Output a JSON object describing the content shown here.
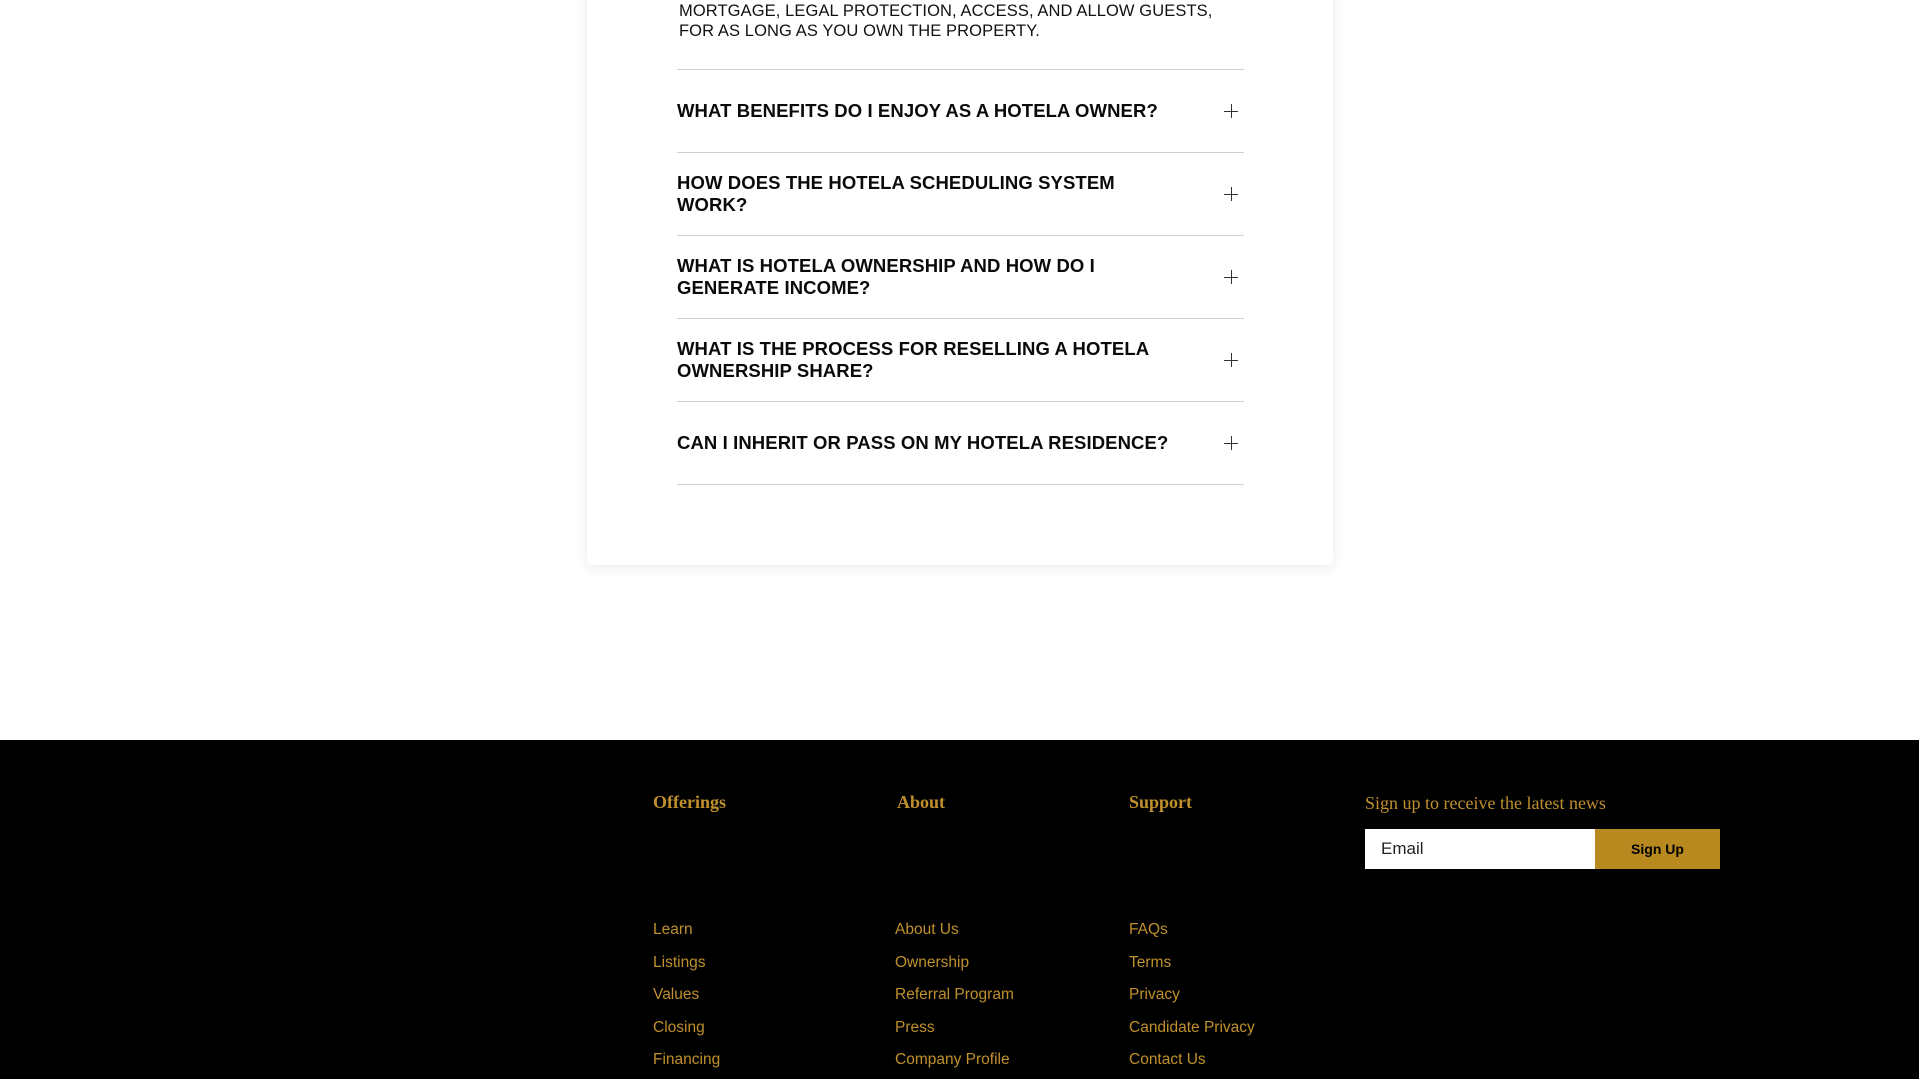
{
  "faq": {
    "answer_text": "MORTGAGE, LEGAL PROTECTION, ACCESS, AND ALLOW GUESTS, FOR AS LONG AS YOU OWN THE PROPERTY.",
    "questions": [
      "WHAT BENEFITS DO I ENJOY AS A HOTELA OWNER?",
      "HOW DOES THE HOTELA SCHEDULING SYSTEM WORK?",
      "WHAT IS HOTELA OWNERSHIP AND HOW DO I GENERATE INCOME?",
      "WHAT IS THE PROCESS FOR RESELLING A HOTELA OWNERSHIP SHARE?",
      "CAN I INHERIT OR PASS ON MY HOTELA RESIDENCE?"
    ]
  },
  "footer": {
    "offerings": {
      "heading": "Offerings",
      "links": [
        "Learn",
        "Listings",
        "Values",
        "Closing",
        "Financing"
      ]
    },
    "about": {
      "heading": "About",
      "links": [
        "About Us",
        "Ownership",
        "Referral Program",
        "Press",
        "Company Profile"
      ]
    },
    "support": {
      "heading": "Support",
      "links": [
        "FAQs",
        "Terms",
        "Privacy",
        "Candidate Privacy",
        "Contact Us"
      ]
    },
    "newsletter": {
      "title": "Sign up to receive the latest news",
      "email_placeholder": "Email",
      "button_label": "Sign Up"
    }
  },
  "colors": {
    "gold": "#c0902d",
    "button_gold": "#b8891f",
    "footer_bg": "#000000"
  }
}
